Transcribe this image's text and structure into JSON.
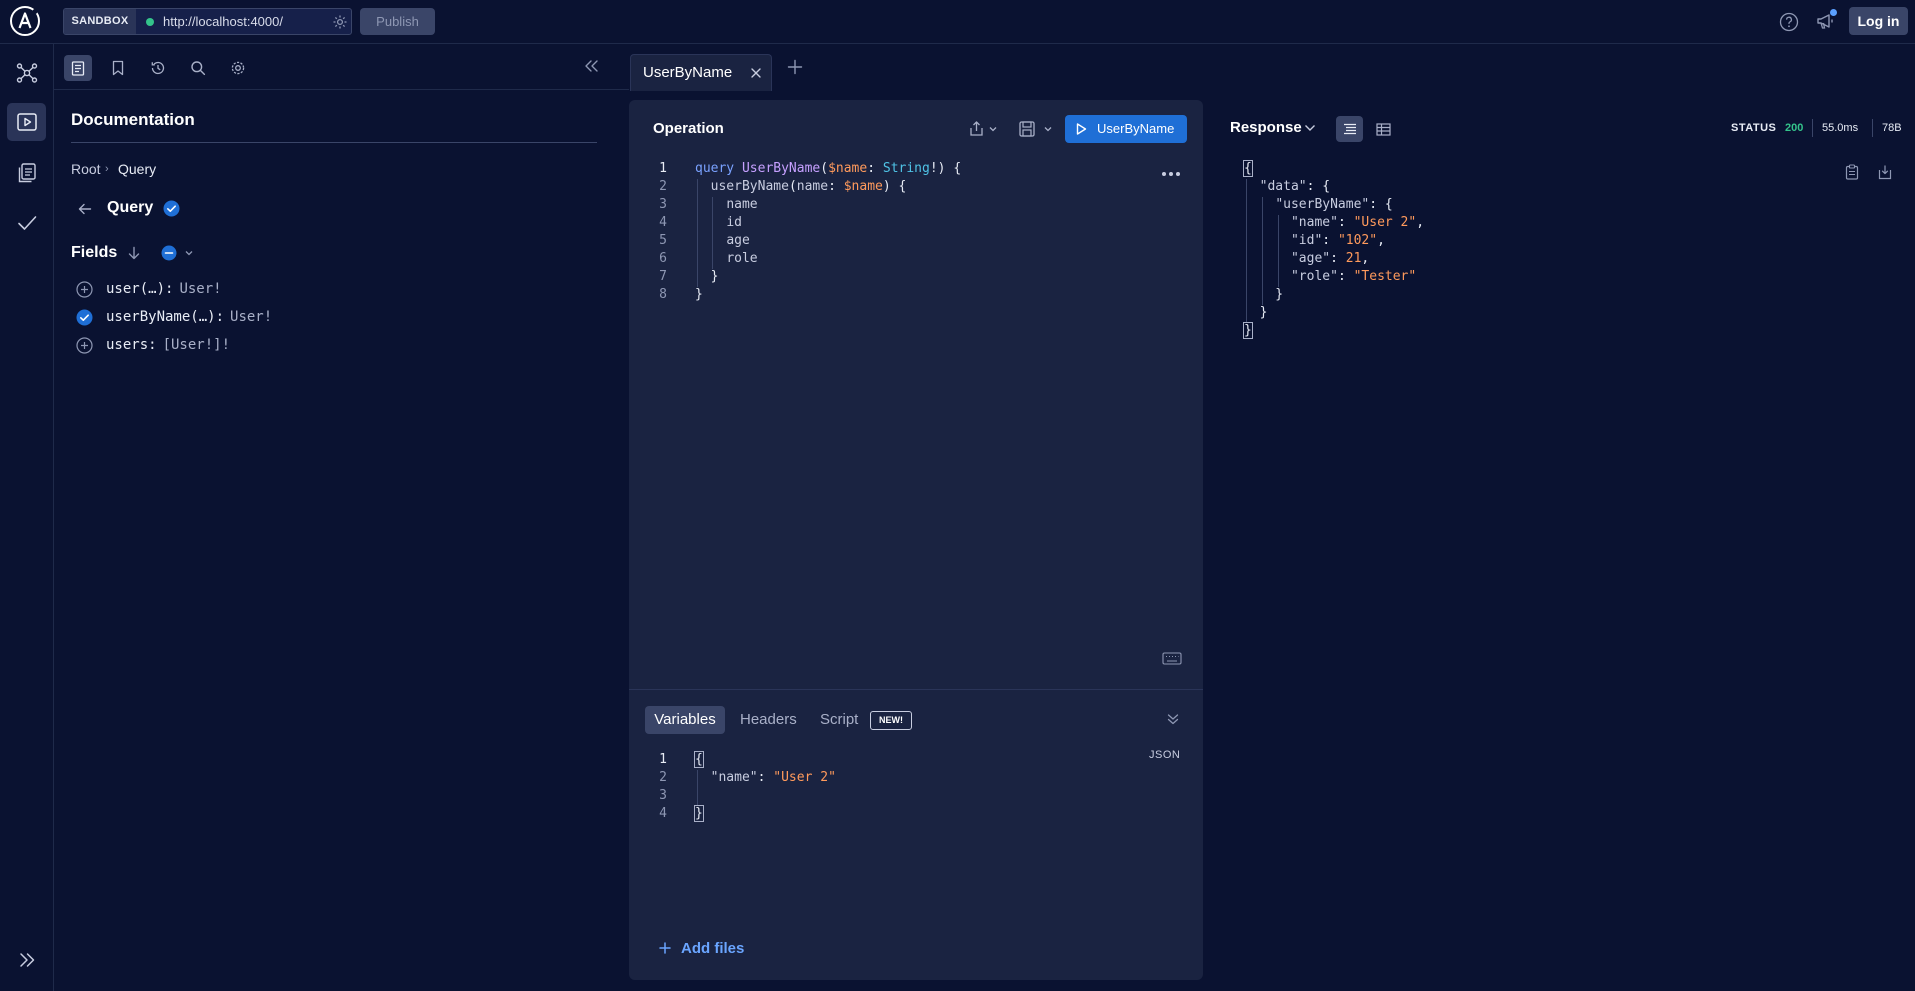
{
  "header": {
    "sandbox_label": "SANDBOX",
    "endpoint_url": "http://localhost:4000/",
    "publish_label": "Publish",
    "login_label": "Log in"
  },
  "rail": {
    "icons": [
      "schema-icon",
      "explorer-icon",
      "collections-icon",
      "checks-icon",
      "expand-icon"
    ]
  },
  "documentation": {
    "title": "Documentation",
    "breadcrumb": [
      "Root",
      "Query"
    ],
    "type_name": "Query",
    "fields_title": "Fields",
    "fields": [
      {
        "name": "user(…):",
        "type": "User!",
        "selected": false
      },
      {
        "name": "userByName(…):",
        "type": "User!",
        "selected": true
      },
      {
        "name": "users:",
        "type": "[User!]!",
        "selected": false
      }
    ]
  },
  "tabs": {
    "active_label": "UserByName"
  },
  "operation": {
    "title": "Operation",
    "run_label": "UserByName",
    "line_numbers": [
      "1",
      "2",
      "3",
      "4",
      "5",
      "6",
      "7",
      "8"
    ],
    "lines": [
      [
        [
          "k",
          "query "
        ],
        [
          "fn",
          "UserByName"
        ],
        [
          "p",
          "("
        ],
        [
          "v",
          "$name"
        ],
        [
          "p",
          ": "
        ],
        [
          "t",
          "String"
        ],
        [
          "p",
          "!) {"
        ]
      ],
      [
        [
          "p",
          "  "
        ],
        [
          "f",
          "userByName"
        ],
        [
          "p",
          "("
        ],
        [
          "f",
          "name"
        ],
        [
          "p",
          ": "
        ],
        [
          "v",
          "$name"
        ],
        [
          "p",
          ") {"
        ]
      ],
      [
        [
          "p",
          "    "
        ],
        [
          "f",
          "name"
        ]
      ],
      [
        [
          "p",
          "    "
        ],
        [
          "f",
          "id"
        ]
      ],
      [
        [
          "p",
          "    "
        ],
        [
          "f",
          "age"
        ]
      ],
      [
        [
          "p",
          "    "
        ],
        [
          "f",
          "role"
        ]
      ],
      [
        [
          "p",
          "  }"
        ]
      ],
      [
        [
          "p",
          "}"
        ]
      ]
    ]
  },
  "variables": {
    "tabs": [
      "Variables",
      "Headers",
      "Script"
    ],
    "new_badge": "NEW!",
    "format_label": "JSON",
    "line_numbers": [
      "1",
      "2",
      "3",
      "4"
    ],
    "lines": [
      [
        [
          "p",
          "{"
        ]
      ],
      [
        [
          "p",
          "  "
        ],
        [
          "f",
          "\"name\""
        ],
        [
          "p",
          ": "
        ],
        [
          "s",
          "\"User 2\""
        ]
      ],
      [
        [
          "p",
          ""
        ]
      ],
      [
        [
          "p",
          "}"
        ]
      ]
    ],
    "add_files_label": "Add files"
  },
  "response": {
    "title": "Response",
    "status_label": "STATUS",
    "status_code": "200",
    "time": "55.0ms",
    "size": "78B",
    "lines": [
      [
        [
          "p",
          "{"
        ]
      ],
      [
        [
          "p",
          "  "
        ],
        [
          "f",
          "\"data\""
        ],
        [
          "p",
          ": {"
        ]
      ],
      [
        [
          "p",
          "    "
        ],
        [
          "f",
          "\"userByName\""
        ],
        [
          "p",
          ": {"
        ]
      ],
      [
        [
          "p",
          "      "
        ],
        [
          "f",
          "\"name\""
        ],
        [
          "p",
          ": "
        ],
        [
          "s",
          "\"User 2\""
        ],
        [
          "p",
          ","
        ]
      ],
      [
        [
          "p",
          "      "
        ],
        [
          "f",
          "\"id\""
        ],
        [
          "p",
          ": "
        ],
        [
          "s",
          "\"102\""
        ],
        [
          "p",
          ","
        ]
      ],
      [
        [
          "p",
          "      "
        ],
        [
          "f",
          "\"age\""
        ],
        [
          "p",
          ": "
        ],
        [
          "v",
          "21"
        ],
        [
          "p",
          ","
        ]
      ],
      [
        [
          "p",
          "      "
        ],
        [
          "f",
          "\"role\""
        ],
        [
          "p",
          ": "
        ],
        [
          "s",
          "\"Tester\""
        ]
      ],
      [
        [
          "p",
          "    }"
        ]
      ],
      [
        [
          "p",
          "  }"
        ]
      ],
      [
        [
          "p",
          "}"
        ]
      ]
    ]
  },
  "colors": {
    "background": "#0a1231",
    "panel": "#1a2341",
    "accent": "#1f6fd6",
    "status_ok": "#34c48b",
    "keyword": "#7aa2ff",
    "variable": "#ff9a5c",
    "type": "#4fc3e6"
  }
}
